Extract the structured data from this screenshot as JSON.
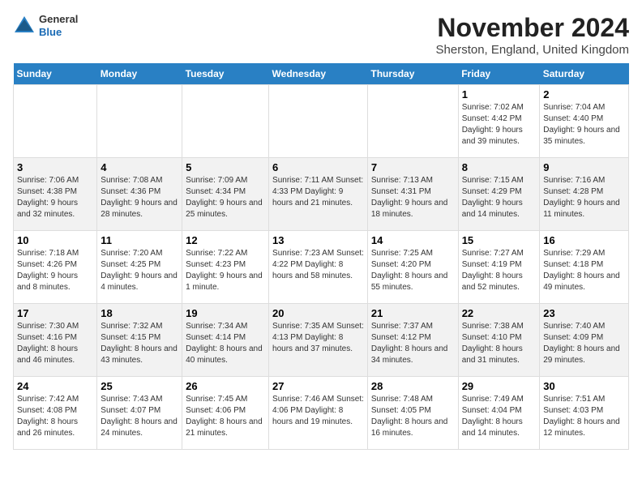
{
  "logo": {
    "line1": "General",
    "line2": "Blue"
  },
  "title": "November 2024",
  "subtitle": "Sherston, England, United Kingdom",
  "weekdays": [
    "Sunday",
    "Monday",
    "Tuesday",
    "Wednesday",
    "Thursday",
    "Friday",
    "Saturday"
  ],
  "weeks": [
    [
      {
        "day": "",
        "info": ""
      },
      {
        "day": "",
        "info": ""
      },
      {
        "day": "",
        "info": ""
      },
      {
        "day": "",
        "info": ""
      },
      {
        "day": "",
        "info": ""
      },
      {
        "day": "1",
        "info": "Sunrise: 7:02 AM\nSunset: 4:42 PM\nDaylight: 9 hours\nand 39 minutes."
      },
      {
        "day": "2",
        "info": "Sunrise: 7:04 AM\nSunset: 4:40 PM\nDaylight: 9 hours\nand 35 minutes."
      }
    ],
    [
      {
        "day": "3",
        "info": "Sunrise: 7:06 AM\nSunset: 4:38 PM\nDaylight: 9 hours\nand 32 minutes."
      },
      {
        "day": "4",
        "info": "Sunrise: 7:08 AM\nSunset: 4:36 PM\nDaylight: 9 hours\nand 28 minutes."
      },
      {
        "day": "5",
        "info": "Sunrise: 7:09 AM\nSunset: 4:34 PM\nDaylight: 9 hours\nand 25 minutes."
      },
      {
        "day": "6",
        "info": "Sunrise: 7:11 AM\nSunset: 4:33 PM\nDaylight: 9 hours\nand 21 minutes."
      },
      {
        "day": "7",
        "info": "Sunrise: 7:13 AM\nSunset: 4:31 PM\nDaylight: 9 hours\nand 18 minutes."
      },
      {
        "day": "8",
        "info": "Sunrise: 7:15 AM\nSunset: 4:29 PM\nDaylight: 9 hours\nand 14 minutes."
      },
      {
        "day": "9",
        "info": "Sunrise: 7:16 AM\nSunset: 4:28 PM\nDaylight: 9 hours\nand 11 minutes."
      }
    ],
    [
      {
        "day": "10",
        "info": "Sunrise: 7:18 AM\nSunset: 4:26 PM\nDaylight: 9 hours\nand 8 minutes."
      },
      {
        "day": "11",
        "info": "Sunrise: 7:20 AM\nSunset: 4:25 PM\nDaylight: 9 hours\nand 4 minutes."
      },
      {
        "day": "12",
        "info": "Sunrise: 7:22 AM\nSunset: 4:23 PM\nDaylight: 9 hours\nand 1 minute."
      },
      {
        "day": "13",
        "info": "Sunrise: 7:23 AM\nSunset: 4:22 PM\nDaylight: 8 hours\nand 58 minutes."
      },
      {
        "day": "14",
        "info": "Sunrise: 7:25 AM\nSunset: 4:20 PM\nDaylight: 8 hours\nand 55 minutes."
      },
      {
        "day": "15",
        "info": "Sunrise: 7:27 AM\nSunset: 4:19 PM\nDaylight: 8 hours\nand 52 minutes."
      },
      {
        "day": "16",
        "info": "Sunrise: 7:29 AM\nSunset: 4:18 PM\nDaylight: 8 hours\nand 49 minutes."
      }
    ],
    [
      {
        "day": "17",
        "info": "Sunrise: 7:30 AM\nSunset: 4:16 PM\nDaylight: 8 hours\nand 46 minutes."
      },
      {
        "day": "18",
        "info": "Sunrise: 7:32 AM\nSunset: 4:15 PM\nDaylight: 8 hours\nand 43 minutes."
      },
      {
        "day": "19",
        "info": "Sunrise: 7:34 AM\nSunset: 4:14 PM\nDaylight: 8 hours\nand 40 minutes."
      },
      {
        "day": "20",
        "info": "Sunrise: 7:35 AM\nSunset: 4:13 PM\nDaylight: 8 hours\nand 37 minutes."
      },
      {
        "day": "21",
        "info": "Sunrise: 7:37 AM\nSunset: 4:12 PM\nDaylight: 8 hours\nand 34 minutes."
      },
      {
        "day": "22",
        "info": "Sunrise: 7:38 AM\nSunset: 4:10 PM\nDaylight: 8 hours\nand 31 minutes."
      },
      {
        "day": "23",
        "info": "Sunrise: 7:40 AM\nSunset: 4:09 PM\nDaylight: 8 hours\nand 29 minutes."
      }
    ],
    [
      {
        "day": "24",
        "info": "Sunrise: 7:42 AM\nSunset: 4:08 PM\nDaylight: 8 hours\nand 26 minutes."
      },
      {
        "day": "25",
        "info": "Sunrise: 7:43 AM\nSunset: 4:07 PM\nDaylight: 8 hours\nand 24 minutes."
      },
      {
        "day": "26",
        "info": "Sunrise: 7:45 AM\nSunset: 4:06 PM\nDaylight: 8 hours\nand 21 minutes."
      },
      {
        "day": "27",
        "info": "Sunrise: 7:46 AM\nSunset: 4:06 PM\nDaylight: 8 hours\nand 19 minutes."
      },
      {
        "day": "28",
        "info": "Sunrise: 7:48 AM\nSunset: 4:05 PM\nDaylight: 8 hours\nand 16 minutes."
      },
      {
        "day": "29",
        "info": "Sunrise: 7:49 AM\nSunset: 4:04 PM\nDaylight: 8 hours\nand 14 minutes."
      },
      {
        "day": "30",
        "info": "Sunrise: 7:51 AM\nSunset: 4:03 PM\nDaylight: 8 hours\nand 12 minutes."
      }
    ]
  ],
  "colors": {
    "header_bg": "#2980c4",
    "header_text": "#ffffff",
    "even_row": "#f2f2f2",
    "border": "#dddddd"
  }
}
